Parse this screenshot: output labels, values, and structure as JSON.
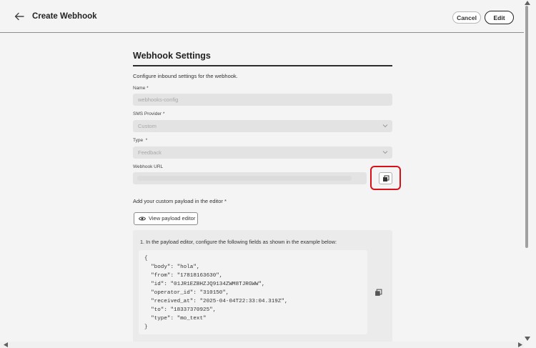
{
  "header": {
    "title": "Create Webhook",
    "cancel_label": "Cancel",
    "edit_label": "Edit"
  },
  "section": {
    "title": "Webhook Settings",
    "description": "Configure inbound settings for the webhook."
  },
  "fields": {
    "name": {
      "label": "Name",
      "required": "*",
      "value": "webhooks-config"
    },
    "provider": {
      "label": "SMS Provider",
      "required": "*",
      "value": "Custom"
    },
    "type": {
      "label": "Type",
      "required": "*",
      "value": "Feedback"
    },
    "url": {
      "label": "Webhook URL"
    }
  },
  "payload": {
    "label": "Add your custom payload in the editor *",
    "view_button": "View payload editor",
    "step1": "1. In the payload editor, configure the following fields as shown in the example below:",
    "code_lines": [
      "{",
      "  \"body\": \"hola\",",
      "  \"from\": \"17818163630\",",
      "  \"id\": \"01JR1EZBHZJQ9134ZWM8TJRGWW\",",
      "  \"operator_id\": \"310150\",",
      "  \"received_at\": \"2025-04-04T22:33:04.319Z\",",
      "  \"to\": \"18337370925\",",
      "  \"type\": \"mo_text\"",
      "}"
    ]
  },
  "colors": {
    "highlight": "#d7101a",
    "rule": "#2c2c2c",
    "field_bg": "#e3e3e3"
  },
  "icons": {
    "back": "arrow-left-icon",
    "copy": "copy-icon",
    "view": "eye-icon",
    "dropdown": "chevron-down-icon"
  }
}
